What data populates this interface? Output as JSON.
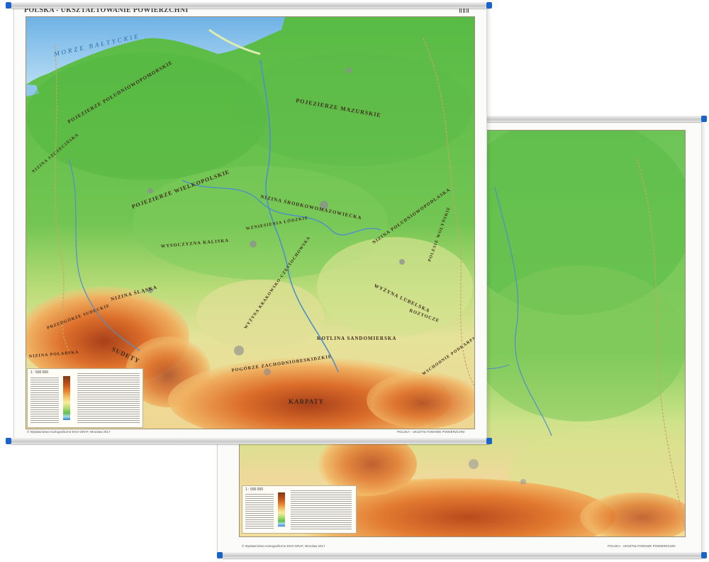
{
  "map_front": {
    "title": "POLSKA - UKSZTAŁTOWANIE POWIERZCHNI",
    "sea_label": "MORZE BAŁTYCKIE",
    "region_labels": [
      "POJEZIERZE POŁUDNIOWOPOMORSKIE",
      "POJEZIERZE MAZURSKIE",
      "POJEZIERZE WIELKOPOLSKIE",
      "NIZINA POŁUDNIOWOPODLASKA",
      "NIZINA ŚRODKOWOMAZOWIECKA",
      "WYŻYNA KRAKOWSKO-CZĘSTOCHOWSKA",
      "WYŻYNA LUBELSKA",
      "KOTLINA SANDOMIERSKA",
      "POGÓRZE ZACHODNIOBESKIDZKIE",
      "WZNIESIENIA ŁÓDZKIE",
      "WYSOCZYZNA KALISKA",
      "NIZINA ŚLĄSKA",
      "PRZEDGÓRZE SUDECKIE",
      "KARPATY",
      "SUDETY",
      "NIZINA POŁABSKA",
      "WSCHODNIE PODKARPACIE",
      "ROZTOCZE",
      "POLESIE WOŁYŃSKIE",
      "NIZINA SZCZECIŃSKA"
    ],
    "legend": {
      "scale": "1 : 500 000"
    },
    "footer_left": "© Wydawnictwo Kartograficzne EKO-GRAF, Wrocław 2017",
    "footer_right": "POLSKA - UKSZTAŁTOWANIE POWIERZCHNI"
  },
  "map_back": {
    "legend": {
      "scale": "1 : 500 000"
    },
    "footer_left": "© Wydawnictwo Kartograficzne EKO-GRAF, Wrocław 2017",
    "footer_right": "POLSKA - UKSZTAŁTOWANIE POWIERZCHNI"
  },
  "colors": {
    "lowland": "#5fbf4a",
    "upland": "#d8e58a",
    "highland": "#e88a3a",
    "mountain": "#b94a1d",
    "sea": "#8ec6ec",
    "rail_cap": "#1a63c9"
  }
}
